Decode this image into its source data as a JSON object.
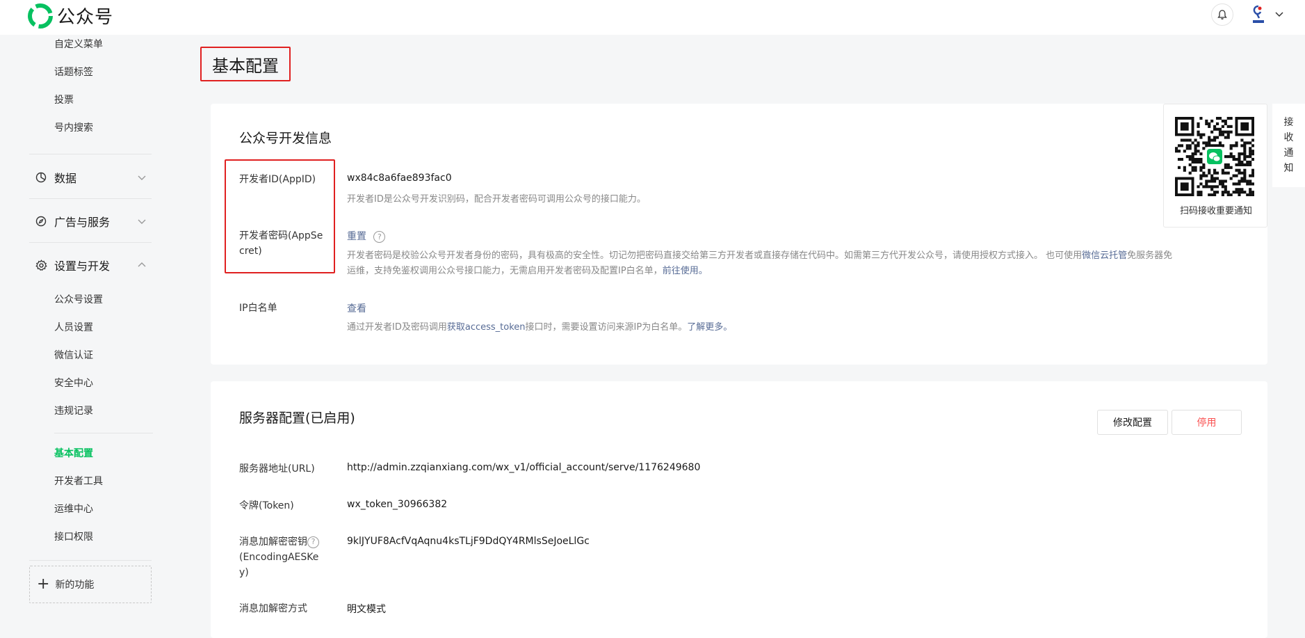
{
  "app": {
    "name": "公众号",
    "brand_color": "#07c160"
  },
  "sidebar": {
    "top_items": [
      {
        "label": "自定义菜单"
      },
      {
        "label": "话题标签"
      },
      {
        "label": "投票"
      },
      {
        "label": "号内搜索"
      }
    ],
    "groups": [
      {
        "label": "数据",
        "icon": "pie-chart-icon",
        "expanded": false
      },
      {
        "label": "广告与服务",
        "icon": "compass-icon",
        "expanded": false
      },
      {
        "label": "设置与开发",
        "icon": "gear-icon",
        "expanded": true
      }
    ],
    "settings_items": [
      {
        "label": "公众号设置"
      },
      {
        "label": "人员设置"
      },
      {
        "label": "微信认证"
      },
      {
        "label": "安全中心"
      },
      {
        "label": "违规记录"
      }
    ],
    "dev_items": [
      {
        "label": "基本配置",
        "active": true
      },
      {
        "label": "开发者工具"
      },
      {
        "label": "运维中心"
      },
      {
        "label": "接口权限"
      }
    ],
    "new_feature": "新的功能"
  },
  "page": {
    "title": "基本配置"
  },
  "dev_info": {
    "title": "公众号开发信息",
    "appid_label": "开发者ID(AppID)",
    "appid_value": "wx84c8a6fae893fac0",
    "appid_desc": "开发者ID是公众号开发识别码，配合开发者密码可调用公众号的接口能力。",
    "secret_label_1": "开发者密码(AppSe",
    "secret_label_2": "cret)",
    "secret_reset": "重置",
    "secret_desc_1a": "开发者密码是校验公众号开发者身份的密码，具有极高的安全性。切记勿把密码直接交给第三方开发者或直接存储在代码中。如需第三方代开发公众号，请使用授权方式接入。 也可使用",
    "secret_desc_link1": "微信云托管",
    "secret_desc_1b": "免服务器免",
    "secret_desc_2a": "运维，支持免鉴权调用公众号接口能力，无需启用开发者密码及配置IP白名单，",
    "secret_desc_link2": "前往使用。",
    "ip_label": "IP白名单",
    "ip_view": "查看",
    "ip_desc_a": "通过开发者ID及密码调用",
    "ip_desc_link1": "获取access_token",
    "ip_desc_b": "接口时，需要设置访问来源IP为白名单。",
    "ip_desc_link2": "了解更多。"
  },
  "server": {
    "title": "服务器配置(已启用)",
    "modify_button": "修改配置",
    "disable_button": "停用",
    "url_label": "服务器地址(URL)",
    "url_value": "http://admin.zzqianxiang.com/wx_v1/official_account/serve/1176249680",
    "token_label": "令牌(Token)",
    "token_value": "wx_token_30966382",
    "aes_label_1": "消息加解密密钥",
    "aes_label_2": "(EncodingAESKe",
    "aes_label_3": "y)",
    "aes_value": "9klJYUF8AcfVqAqnu4ksTLjF9DdQY4RMlsSeJoeLlGc",
    "mode_label": "消息加解密方式",
    "mode_value": "明文模式"
  },
  "qr": {
    "caption": "扫码接收重要通知",
    "tab_chars": [
      "接",
      "收",
      "通",
      "知"
    ]
  }
}
